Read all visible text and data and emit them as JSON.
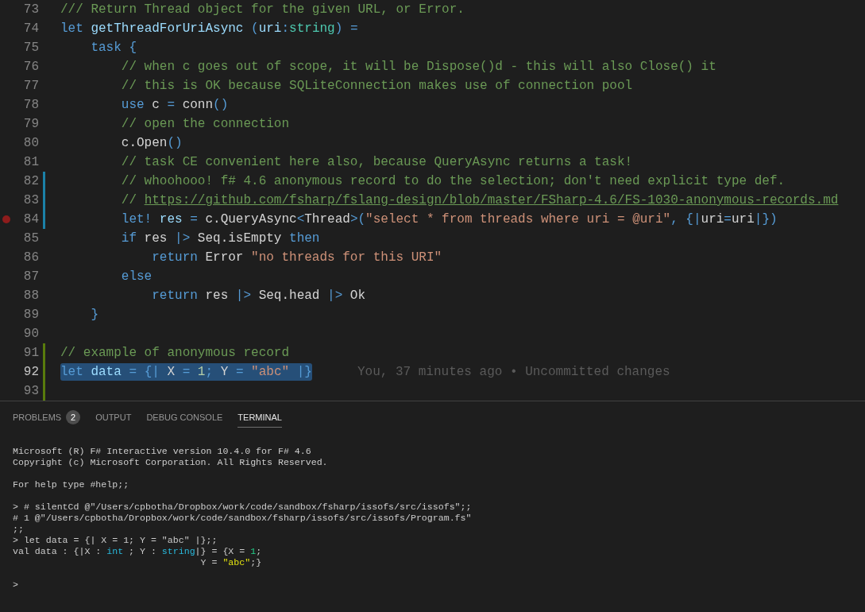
{
  "editor": {
    "lines": [
      {
        "number": "73",
        "selected": false,
        "breakpoint": false,
        "tokens": [
          {
            "kind": "comment",
            "text": "/// Return Thread object for the given URL, or Error."
          }
        ]
      },
      {
        "number": "74",
        "selected": false,
        "breakpoint": false,
        "tokens": [
          {
            "kind": "kw",
            "text": "let"
          },
          {
            "kind": "ident",
            "text": " getThreadForUriAsync"
          },
          {
            "kind": "punct",
            "text": " ("
          },
          {
            "kind": "ident",
            "text": "uri"
          },
          {
            "kind": "punct",
            "text": ":"
          },
          {
            "kind": "type",
            "text": "string"
          },
          {
            "kind": "punct",
            "text": ") ="
          }
        ]
      },
      {
        "number": "75",
        "selected": false,
        "breakpoint": false,
        "tokens": [
          {
            "kind": "kw",
            "text": "    task"
          },
          {
            "kind": "punct",
            "text": " {"
          }
        ]
      },
      {
        "number": "76",
        "selected": false,
        "breakpoint": false,
        "tokens": [
          {
            "kind": "comment",
            "text": "        // when c goes out of scope, it will be Dispose()d - this will also Close() it"
          }
        ]
      },
      {
        "number": "77",
        "selected": false,
        "breakpoint": false,
        "tokens": [
          {
            "kind": "comment",
            "text": "        // this is OK because SQLiteConnection makes use of connection pool"
          }
        ]
      },
      {
        "number": "78",
        "selected": false,
        "breakpoint": false,
        "tokens": [
          {
            "kind": "kw",
            "text": "        use"
          },
          {
            "kind": "plain",
            "text": " c"
          },
          {
            "kind": "punct",
            "text": " = "
          },
          {
            "kind": "plain",
            "text": "conn"
          },
          {
            "kind": "punct",
            "text": "()"
          }
        ]
      },
      {
        "number": "79",
        "selected": false,
        "breakpoint": false,
        "tokens": [
          {
            "kind": "comment",
            "text": "        // open the connection"
          }
        ]
      },
      {
        "number": "80",
        "selected": false,
        "breakpoint": false,
        "tokens": [
          {
            "kind": "plain",
            "text": "        c.Open"
          },
          {
            "kind": "punct",
            "text": "()"
          }
        ]
      },
      {
        "number": "81",
        "selected": false,
        "breakpoint": false,
        "tokens": [
          {
            "kind": "comment",
            "text": "        // task CE convenient here also, because QueryAsync returns a task!"
          }
        ]
      },
      {
        "number": "82",
        "selected": false,
        "breakpoint": false,
        "color": "#1b81a8",
        "tokens": [
          {
            "kind": "comment",
            "text": "        // whoohooo! f# 4.6 anonymous record to do the selection; don't need explicit type def."
          }
        ]
      },
      {
        "number": "83",
        "selected": false,
        "breakpoint": false,
        "color": "#1b81a8",
        "tokens": [
          {
            "kind": "comment",
            "text": "        // "
          },
          {
            "kind": "link",
            "text": "https://github.com/fsharp/fslang-design/blob/master/FSharp-4.6/FS-1030-anonymous-records.md"
          }
        ]
      },
      {
        "number": "84",
        "selected": false,
        "breakpoint": true,
        "color": "#1b81a8",
        "tokens": [
          {
            "kind": "kw",
            "text": "        let!"
          },
          {
            "kind": "ident",
            "text": " res"
          },
          {
            "kind": "punct",
            "text": " = "
          },
          {
            "kind": "plain",
            "text": "c.QueryAsync"
          },
          {
            "kind": "punct",
            "text": "<"
          },
          {
            "kind": "plain",
            "text": "Thread"
          },
          {
            "kind": "punct",
            "text": ">("
          },
          {
            "kind": "string",
            "text": "\"select * from threads where uri = @uri\""
          },
          {
            "kind": "punct",
            "text": ", {|"
          },
          {
            "kind": "plain",
            "text": "uri"
          },
          {
            "kind": "punct",
            "text": "="
          },
          {
            "kind": "plain",
            "text": "uri"
          },
          {
            "kind": "punct",
            "text": "|})"
          }
        ]
      },
      {
        "number": "85",
        "selected": false,
        "breakpoint": false,
        "tokens": [
          {
            "kind": "kw",
            "text": "        if"
          },
          {
            "kind": "plain",
            "text": " res "
          },
          {
            "kind": "punct",
            "text": "|>"
          },
          {
            "kind": "plain",
            "text": " Seq.isEmpty "
          },
          {
            "kind": "kw",
            "text": "then"
          }
        ]
      },
      {
        "number": "86",
        "selected": false,
        "breakpoint": false,
        "tokens": [
          {
            "kind": "kw",
            "text": "            return"
          },
          {
            "kind": "plain",
            "text": " Error "
          },
          {
            "kind": "string",
            "text": "\"no threads for this URI\""
          }
        ]
      },
      {
        "number": "87",
        "selected": false,
        "breakpoint": false,
        "tokens": [
          {
            "kind": "kw",
            "text": "        else"
          }
        ]
      },
      {
        "number": "88",
        "selected": false,
        "breakpoint": false,
        "tokens": [
          {
            "kind": "kw",
            "text": "            return"
          },
          {
            "kind": "plain",
            "text": " res "
          },
          {
            "kind": "punct",
            "text": "|>"
          },
          {
            "kind": "plain",
            "text": " Seq.head "
          },
          {
            "kind": "punct",
            "text": "|>"
          },
          {
            "kind": "plain",
            "text": " Ok"
          }
        ]
      },
      {
        "number": "89",
        "selected": false,
        "breakpoint": false,
        "tokens": [
          {
            "kind": "punct",
            "text": "    }"
          }
        ]
      },
      {
        "number": "90",
        "selected": false,
        "breakpoint": false
      },
      {
        "number": "91",
        "selected": false,
        "breakpoint": false,
        "color": "#587c0c",
        "tokens": [
          {
            "kind": "comment",
            "text": "// example of anonymous record"
          }
        ]
      },
      {
        "number": "92",
        "selected": true,
        "breakpoint": false,
        "color": "#587c0c",
        "annotation": "You, 37 minutes ago • Uncommitted changes",
        "tokens": [
          {
            "kind": "kw",
            "text": "let"
          },
          {
            "kind": "ident",
            "text": " data"
          },
          {
            "kind": "punct",
            "text": " = {|"
          },
          {
            "kind": "plain",
            "text": " X "
          },
          {
            "kind": "punct",
            "text": "="
          },
          {
            "kind": "number",
            "text": " 1"
          },
          {
            "kind": "punct",
            "text": ";"
          },
          {
            "kind": "plain",
            "text": " Y "
          },
          {
            "kind": "punct",
            "text": "= "
          },
          {
            "kind": "string",
            "text": "\"abc\""
          },
          {
            "kind": "punct",
            "text": " |}"
          }
        ]
      },
      {
        "number": "93",
        "selected": false,
        "breakpoint": false,
        "color": "#587c0c"
      }
    ]
  },
  "panel": {
    "tabs": [
      {
        "label": "PROBLEMS",
        "badge": "2",
        "selected": false
      },
      {
        "label": "OUTPUT",
        "selected": false
      },
      {
        "label": "DEBUG CONSOLE",
        "selected": false
      },
      {
        "label": "TERMINAL",
        "selected": true
      }
    ],
    "terminal": {
      "blocks": [
        [
          [
            {
              "kind": "plain",
              "text": "Microsoft (R) F# Interactive version 10.4.0 for F# 4.6"
            }
          ],
          [
            {
              "kind": "plain",
              "text": "Copyright (c) Microsoft Corporation. All Rights Reserved."
            }
          ]
        ],
        [
          [
            {
              "kind": "plain",
              "text": "For help type #help;;"
            }
          ]
        ],
        [
          [
            {
              "kind": "plain",
              "text": "> # silentCd @\"/Users/cpbotha/Dropbox/work/code/sandbox/fsharp/issofs/src/issofs\";;"
            }
          ],
          [
            {
              "kind": "plain",
              "text": "# 1 @\"/Users/cpbotha/Dropbox/work/code/sandbox/fsharp/issofs/src/issofs/Program.fs\""
            }
          ],
          [
            {
              "kind": "plain",
              "text": ";;"
            }
          ],
          [
            {
              "kind": "plain",
              "text": "> let data = {| X = 1; Y = \"abc\" |};;"
            }
          ],
          [
            {
              "kind": "plain",
              "text": "val data : {|X : "
            },
            {
              "kind": "type",
              "text": "int"
            },
            {
              "kind": "plain",
              "text": " ; Y : "
            },
            {
              "kind": "type",
              "text": "string"
            },
            {
              "kind": "plain",
              "text": "|} = {X = "
            },
            {
              "kind": "number",
              "text": "1"
            },
            {
              "kind": "plain",
              "text": ";"
            }
          ],
          [
            {
              "kind": "plain",
              "text": "                                  Y = "
            },
            {
              "kind": "string",
              "text": "\"abc\""
            },
            {
              "kind": "plain",
              "text": ";}"
            }
          ]
        ],
        [
          [
            {
              "kind": "plain",
              "text": ">"
            }
          ]
        ]
      ]
    }
  }
}
